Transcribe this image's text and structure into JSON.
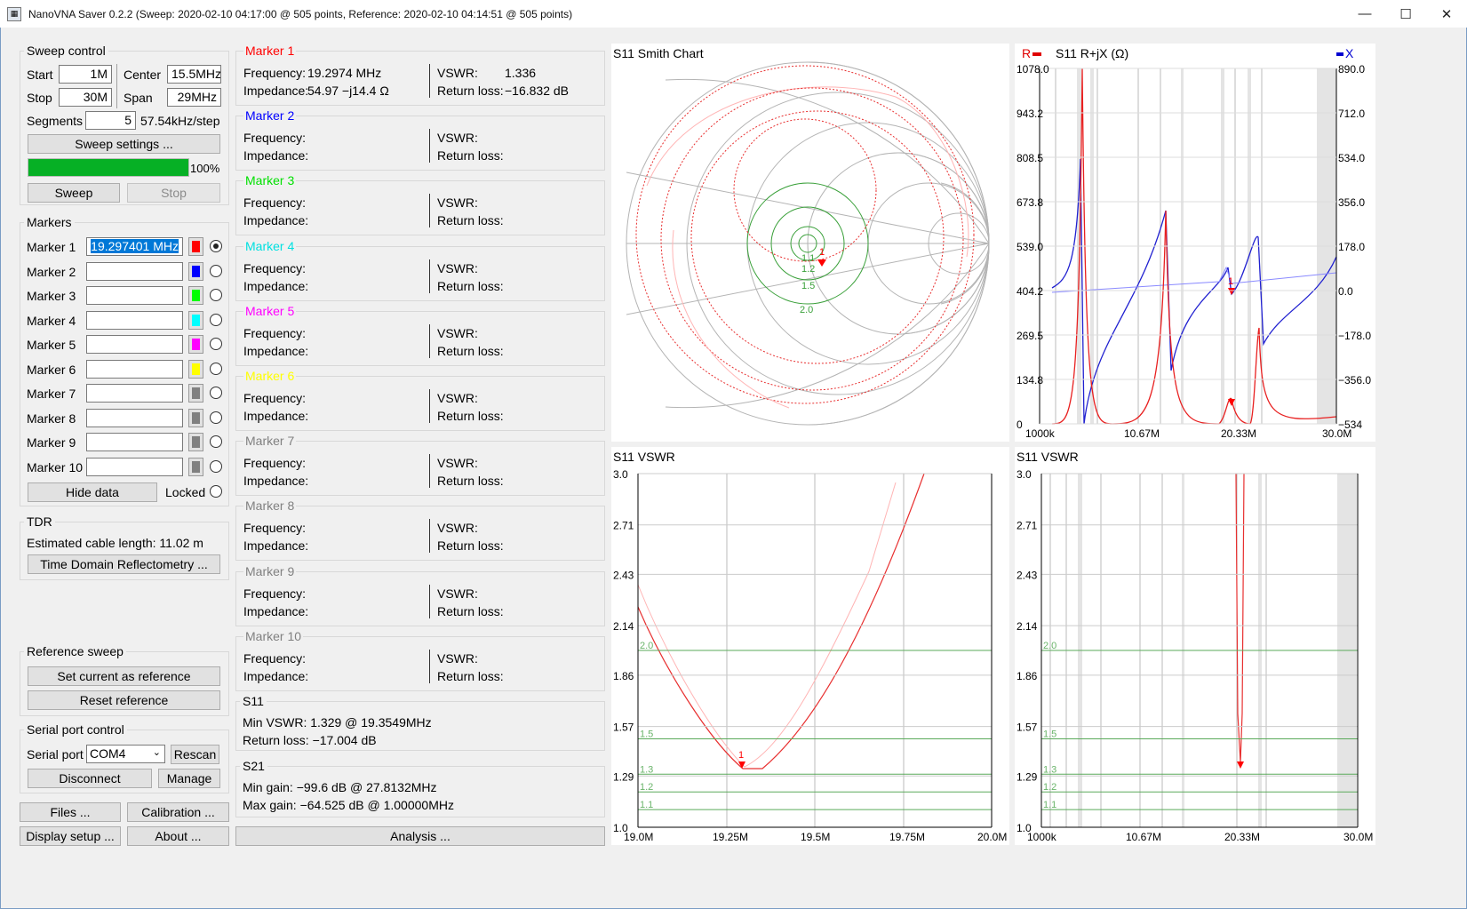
{
  "window": {
    "title": "NanoVNA Saver 0.2.2 (Sweep: 2020-02-10 04:17:00 @ 505 points, Reference: 2020-02-10 04:14:51 @ 505 points)",
    "minimize": "—",
    "maximize": "☐",
    "close": "✕"
  },
  "sweep": {
    "title": "Sweep control",
    "start_label": "Start",
    "start": "1M",
    "center_label": "Center",
    "center": "15.5MHz",
    "stop_label": "Stop",
    "stop": "30M",
    "span_label": "Span",
    "span": "29MHz",
    "segments_label": "Segments",
    "segments": "5",
    "step": "57.54kHz/step",
    "settings_btn": "Sweep settings ...",
    "progress_text": "100%",
    "progress": 1.0,
    "sweep_btn": "Sweep",
    "stop_btn": "Stop"
  },
  "markers": {
    "title": "Markers",
    "items": [
      {
        "label": "Marker 1",
        "value": "19.297401 MHz",
        "color": "#ff0000",
        "selected": true
      },
      {
        "label": "Marker 2",
        "value": "",
        "color": "#0000ff",
        "selected": false
      },
      {
        "label": "Marker 3",
        "value": "",
        "color": "#00ff00",
        "selected": false
      },
      {
        "label": "Marker 4",
        "value": "",
        "color": "#00ffff",
        "selected": false
      },
      {
        "label": "Marker 5",
        "value": "",
        "color": "#ff00ff",
        "selected": false
      },
      {
        "label": "Marker 6",
        "value": "",
        "color": "#ffff00",
        "selected": false
      },
      {
        "label": "Marker 7",
        "value": "",
        "color": "#808080",
        "selected": false
      },
      {
        "label": "Marker 8",
        "value": "",
        "color": "#808080",
        "selected": false
      },
      {
        "label": "Marker 9",
        "value": "",
        "color": "#808080",
        "selected": false
      },
      {
        "label": "Marker 10",
        "value": "",
        "color": "#808080",
        "selected": false
      }
    ],
    "hide_btn": "Hide data",
    "locked_label": "Locked"
  },
  "tdr": {
    "title": "TDR",
    "cable": "Estimated cable length: 11.02 m",
    "btn": "Time Domain Reflectometry ..."
  },
  "reference": {
    "title": "Reference sweep",
    "set_btn": "Set current as reference",
    "reset_btn": "Reset reference"
  },
  "serial": {
    "title": "Serial port control",
    "port_label": "Serial port",
    "port": "COM4",
    "rescan_btn": "Rescan",
    "disconnect_btn": "Disconnect",
    "manage_btn": "Manage"
  },
  "bottom": {
    "files": "Files ...",
    "calibration": "Calibration ...",
    "display": "Display setup ...",
    "about": "About ...",
    "analysis": "Analysis ..."
  },
  "marker_data": [
    {
      "title": "Marker 1",
      "color": "#ff0000",
      "frequency": "19.2974 MHz",
      "impedance": "54.97 −j14.4 Ω",
      "vswr": "1.336",
      "return_loss": "−16.832 dB"
    },
    {
      "title": "Marker 2",
      "color": "#0000ff",
      "frequency": "",
      "impedance": "",
      "vswr": "",
      "return_loss": ""
    },
    {
      "title": "Marker 3",
      "color": "#00e000",
      "frequency": "",
      "impedance": "",
      "vswr": "",
      "return_loss": ""
    },
    {
      "title": "Marker 4",
      "color": "#00e0e0",
      "frequency": "",
      "impedance": "",
      "vswr": "",
      "return_loss": ""
    },
    {
      "title": "Marker 5",
      "color": "#ff00ff",
      "frequency": "",
      "impedance": "",
      "vswr": "",
      "return_loss": ""
    },
    {
      "title": "Marker 6",
      "color": "#ffff00",
      "frequency": "",
      "impedance": "",
      "vswr": "",
      "return_loss": ""
    },
    {
      "title": "Marker 7",
      "color": "#808080",
      "frequency": "",
      "impedance": "",
      "vswr": "",
      "return_loss": ""
    },
    {
      "title": "Marker 8",
      "color": "#808080",
      "frequency": "",
      "impedance": "",
      "vswr": "",
      "return_loss": ""
    },
    {
      "title": "Marker 9",
      "color": "#808080",
      "frequency": "",
      "impedance": "",
      "vswr": "",
      "return_loss": ""
    },
    {
      "title": "Marker 10",
      "color": "#808080",
      "frequency": "",
      "impedance": "",
      "vswr": "",
      "return_loss": ""
    }
  ],
  "labels": {
    "frequency": "Frequency:",
    "impedance": "Impedance:",
    "vswr": "VSWR:",
    "return_loss": "Return loss:"
  },
  "s11": {
    "title": "S11",
    "min_vswr": "Min VSWR:  1.329 @ 19.3549MHz",
    "return_loss": "Return loss: −17.004 dB"
  },
  "s21": {
    "title": "S21",
    "min_gain": "Min gain:  −99.6 dB @ 27.8132MHz",
    "max_gain": "Max gain:  −64.525 dB @ 1.00000MHz"
  },
  "charts": {
    "smith": {
      "title": "S11 Smith Chart",
      "vswr_circles": [
        "1.1",
        "1.2",
        "1.5",
        "2.0"
      ],
      "marker": "1"
    },
    "rjx": {
      "title": "S11  R+jX (Ω)",
      "r_legend": "R",
      "x_legend": "X",
      "y_left": [
        "1078.0",
        "943.2",
        "808.5",
        "673.8",
        "539.0",
        "404.2",
        "269.5",
        "134.8",
        "0"
      ],
      "y_right": [
        "890.0",
        "712.0",
        "534.0",
        "356.0",
        "178.0",
        "0.0",
        "−178.0",
        "−356.0",
        "−534"
      ],
      "x": [
        "1000k",
        "10.67M",
        "20.33M",
        "30.0M"
      ],
      "marker": "1"
    },
    "vswr1": {
      "title": "S11  VSWR",
      "y": [
        "3.0",
        "2.71",
        "2.43",
        "2.14",
        "1.86",
        "1.57",
        "1.29",
        "1.0"
      ],
      "x": [
        "19.0M",
        "19.25M",
        "19.5M",
        "19.75M",
        "20.0M"
      ],
      "ref_lines": [
        "2.0",
        "1.5",
        "1.3",
        "1.2",
        "1.1"
      ],
      "marker": "1"
    },
    "vswr2": {
      "title": "S11  VSWR",
      "y": [
        "3.0",
        "2.71",
        "2.43",
        "2.14",
        "1.86",
        "1.57",
        "1.29",
        "1.0"
      ],
      "x": [
        "1000k",
        "10.67M",
        "20.33M",
        "30.0M"
      ],
      "ref_lines": [
        "2.0",
        "1.5",
        "1.3",
        "1.2",
        "1.1"
      ],
      "marker": "1"
    }
  }
}
